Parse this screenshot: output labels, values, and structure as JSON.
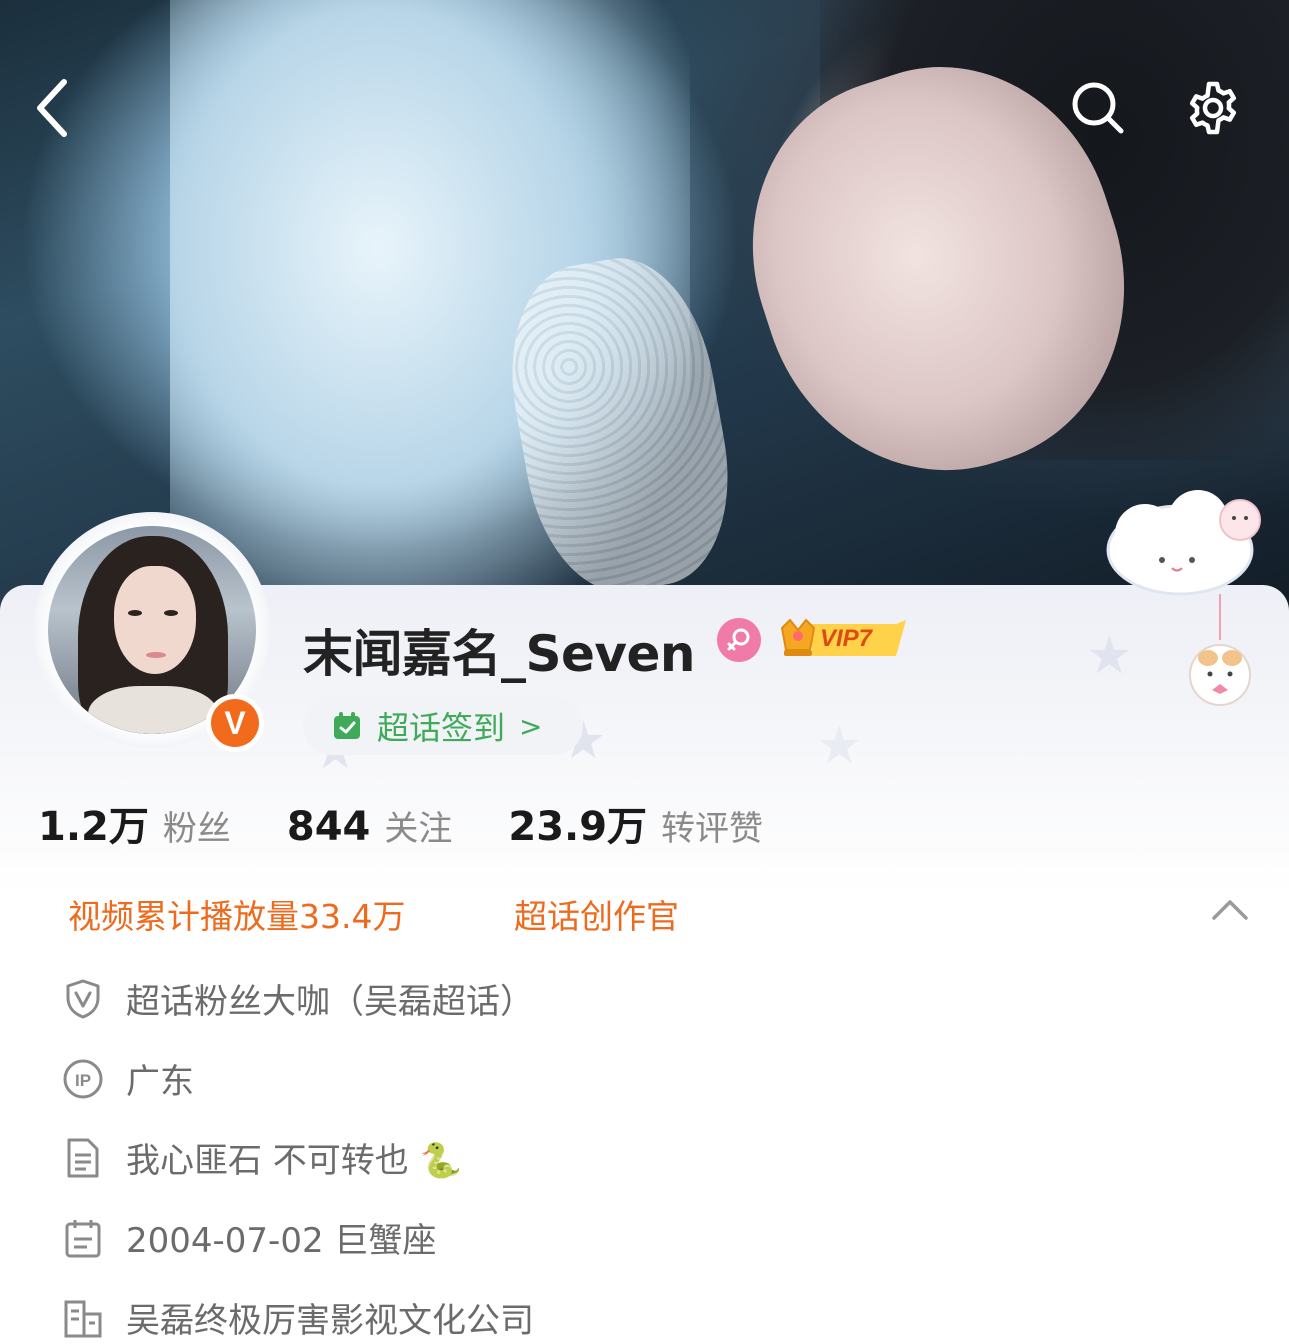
{
  "profile": {
    "username": "末闻嘉名_Seven",
    "vip_label": "VIP7",
    "checkin_label": "超话签到",
    "checkin_arrow": ">",
    "verified_badge": "V"
  },
  "stats": [
    {
      "value": "1.2万",
      "label": "粉丝"
    },
    {
      "value": "844",
      "label": "关注"
    },
    {
      "value": "23.9万",
      "label": "转评赞"
    }
  ],
  "tags": [
    "视频累计播放量33.4万",
    "超话创作官"
  ],
  "info": [
    {
      "icon": "shield-v-icon",
      "text": "超话粉丝大咖（吴磊超话）"
    },
    {
      "icon": "ip-icon",
      "text": "广东"
    },
    {
      "icon": "document-icon",
      "text": "我心匪石 不可转也 🐍"
    },
    {
      "icon": "calendar-icon",
      "text": "2004-07-02 巨蟹座"
    },
    {
      "icon": "company-icon",
      "text": "吴磊终极厉害影视文化公司"
    }
  ],
  "colors": {
    "accent_orange": "#ee6a1d",
    "checkin_green": "#3faa5a",
    "verified_orange": "#f26b1d",
    "gender_pink": "#f07aa8"
  },
  "icons": {
    "back": "chevron-left-icon",
    "search": "search-icon",
    "settings": "gear-icon",
    "collapse": "chevron-up-icon"
  }
}
